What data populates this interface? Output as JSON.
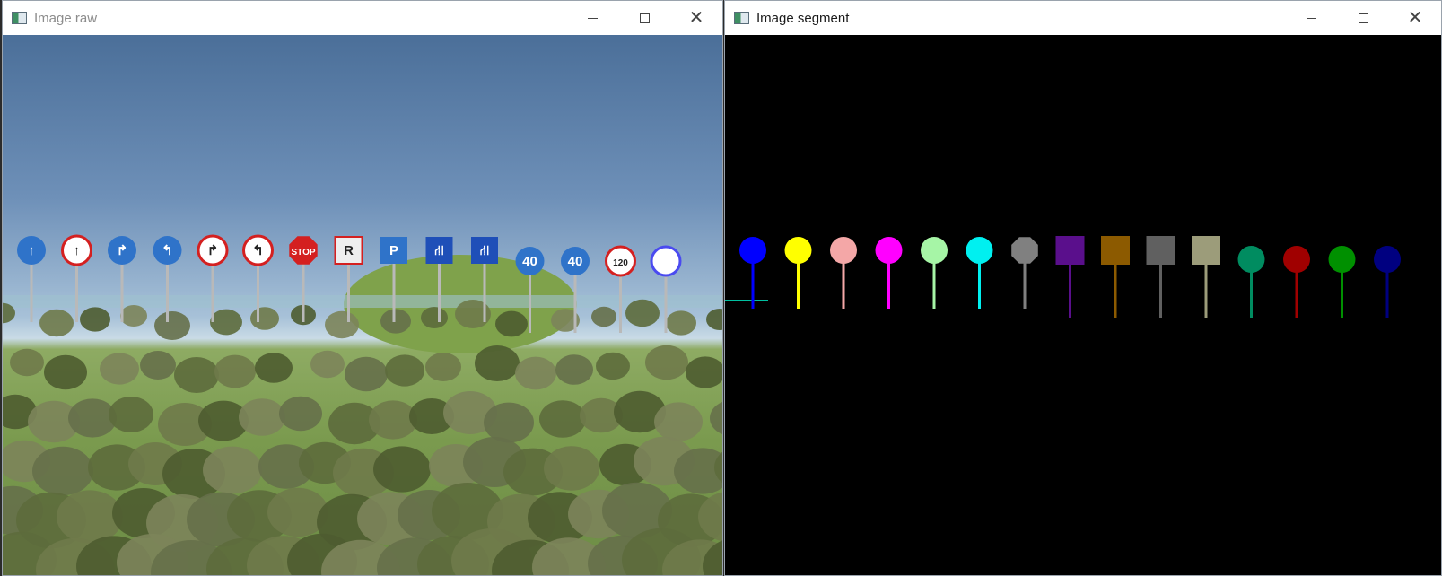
{
  "windows": {
    "raw": {
      "title": "Image raw",
      "icon": "app-window-icon"
    },
    "segment": {
      "title": "Image segment",
      "icon": "app-window-icon"
    }
  },
  "controls": {
    "minimize": "minimize-icon",
    "maximize": "maximize-icon",
    "close": "close-icon"
  },
  "raw_signs": [
    {
      "type": "circle",
      "fill": "#2f73c9",
      "label": "↑"
    },
    {
      "type": "circle",
      "fill": "#ffffff",
      "ring": "#d42020",
      "label": "↑"
    },
    {
      "type": "circle",
      "fill": "#2f73c9",
      "label": "↱"
    },
    {
      "type": "circle",
      "fill": "#2f73c9",
      "label": "↰"
    },
    {
      "type": "circle",
      "fill": "#ffffff",
      "ring": "#d42020",
      "label": "↱"
    },
    {
      "type": "circle",
      "fill": "#ffffff",
      "ring": "#d42020",
      "label": "↰"
    },
    {
      "type": "octagon",
      "fill": "#d42020",
      "label": "STOP"
    },
    {
      "type": "square",
      "fill": "#eeeeee",
      "ring": "#d42020",
      "label": "R"
    },
    {
      "type": "square",
      "fill": "#2f73c9",
      "label": "P"
    },
    {
      "type": "square",
      "fill": "#1f4fb8",
      "label": "⛙"
    },
    {
      "type": "square",
      "fill": "#1f4fb8",
      "label": "⛙"
    },
    {
      "type": "circle",
      "fill": "#2f73c9",
      "label": "40"
    },
    {
      "type": "circle",
      "fill": "#2f73c9",
      "label": "40"
    },
    {
      "type": "circle",
      "fill": "#ffffff",
      "ring": "#d42020",
      "label": "120"
    },
    {
      "type": "circle",
      "fill": "#ffffff",
      "ring": "#4a4af0",
      "label": ""
    }
  ],
  "segment_signs": [
    {
      "shape": "circle",
      "color": "#0000ff"
    },
    {
      "shape": "circle",
      "color": "#ffff00"
    },
    {
      "shape": "circle",
      "color": "#f4a7a7"
    },
    {
      "shape": "circle",
      "color": "#ff00ff"
    },
    {
      "shape": "circle",
      "color": "#a6f5a6"
    },
    {
      "shape": "circle",
      "color": "#00f0f0"
    },
    {
      "shape": "octagon",
      "color": "#808080"
    },
    {
      "shape": "square",
      "color": "#5a0f8c"
    },
    {
      "shape": "square",
      "color": "#8c5a00"
    },
    {
      "shape": "square",
      "color": "#606060"
    },
    {
      "shape": "square",
      "color": "#9c9c7a"
    },
    {
      "shape": "circle",
      "color": "#008c60"
    },
    {
      "shape": "circle",
      "color": "#a00000"
    },
    {
      "shape": "circle",
      "color": "#009000"
    },
    {
      "shape": "circle",
      "color": "#000080"
    }
  ]
}
